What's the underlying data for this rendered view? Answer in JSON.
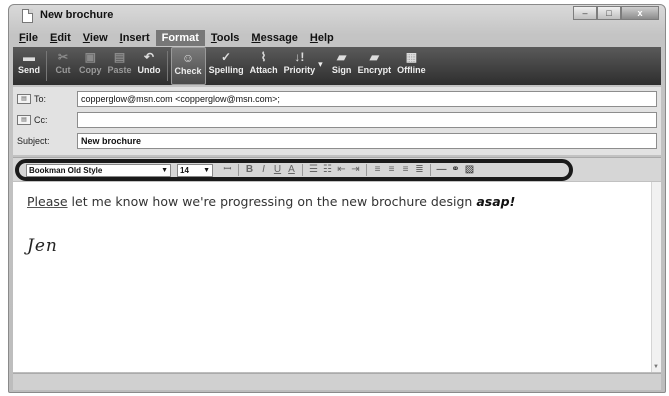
{
  "window": {
    "title": "New brochure",
    "controls": [
      "–",
      "□",
      "x"
    ]
  },
  "menu": [
    {
      "label": "File",
      "u": "F",
      "rest": "ile"
    },
    {
      "label": "Edit",
      "u": "E",
      "rest": "dit"
    },
    {
      "label": "View",
      "u": "V",
      "rest": "iew"
    },
    {
      "label": "Insert",
      "u": "I",
      "rest": "nsert"
    },
    {
      "label": "Format",
      "u": "",
      "rest": "Format"
    },
    {
      "label": "Tools",
      "u": "T",
      "rest": "ools"
    },
    {
      "label": "Message",
      "u": "M",
      "rest": "essage"
    },
    {
      "label": "Help",
      "u": "H",
      "rest": "elp"
    }
  ],
  "toolbar": {
    "send": "Send",
    "cut": "Cut",
    "copy": "Copy",
    "paste": "Paste",
    "undo": "Undo",
    "check": "Check",
    "spelling": "Spelling",
    "attach": "Attach",
    "priority": "Priority",
    "sign": "Sign",
    "encrypt": "Encrypt",
    "offline": "Offline"
  },
  "header": {
    "to_label": "To:",
    "to_value": "copperglow@msn.com <copperglow@msn.com>;",
    "cc_label": "Cc:",
    "cc_value": "",
    "subject_label": "Subject:",
    "subject_value": "New brochure"
  },
  "format": {
    "font": "Bookman Old Style",
    "size": "14"
  },
  "message": {
    "please": "Please",
    "body": " let me know how we're progressing on the new brochure design ",
    "asap": "asap!",
    "signature": "Jen"
  },
  "icons": {
    "send": "send-icon",
    "cut": "scissors-icon",
    "copy": "copy-icon",
    "paste": "paste-icon",
    "undo": "undo-icon",
    "check": "check-names-icon",
    "spelling": "spelling-icon",
    "attach": "paperclip-icon",
    "priority": "priority-icon",
    "sign": "sign-icon",
    "encrypt": "encrypt-icon",
    "offline": "offline-icon"
  }
}
